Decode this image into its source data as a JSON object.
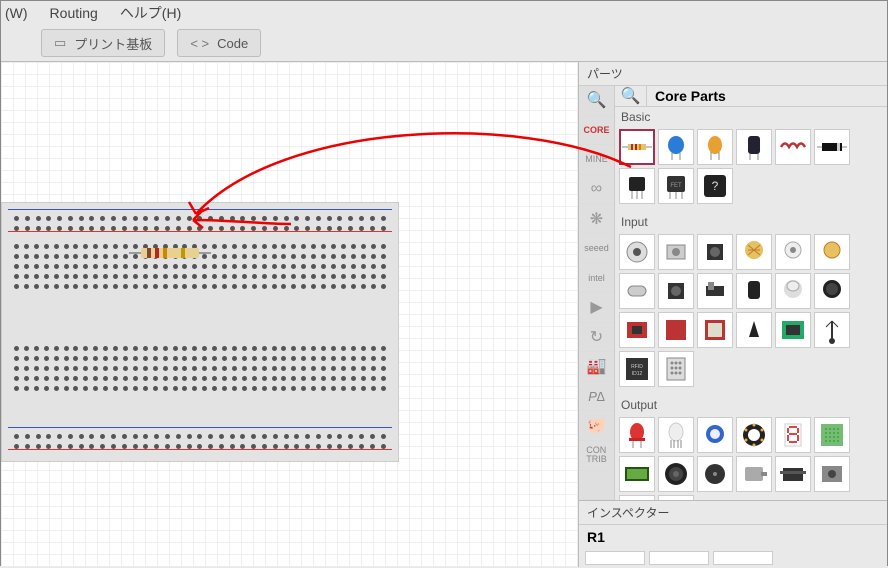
{
  "menu": {
    "window": "(W)",
    "routing": "Routing",
    "help": "ヘルプ(H)"
  },
  "toolbar": {
    "pcb_label": "プリント基板",
    "code_label": "Code"
  },
  "panels": {
    "parts_title": "パーツ",
    "core_parts_title": "Core Parts",
    "inspector_title": "インスペクター"
  },
  "bins": {
    "search": "🔍",
    "core": "CORE",
    "mine": "MINE",
    "arduino": "∞",
    "sparkfun": "seeed",
    "intel": "intel",
    "contrib": "CON\nTRIB"
  },
  "sections": {
    "basic": "Basic",
    "input": "Input",
    "output": "Output"
  },
  "inspector": {
    "selected_name": "R1"
  }
}
